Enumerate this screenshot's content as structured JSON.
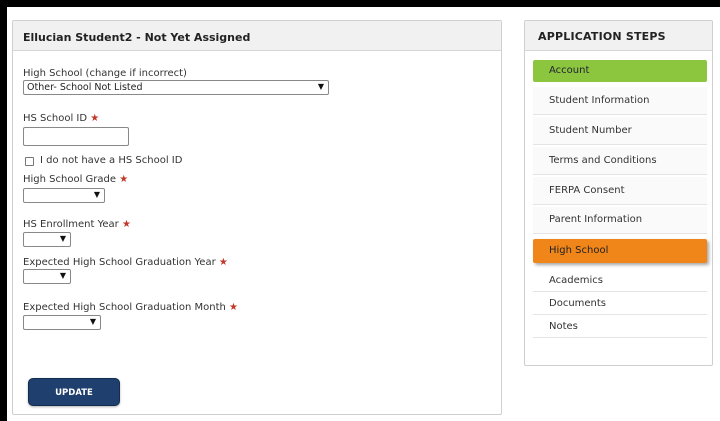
{
  "form": {
    "header": "Ellucian Student2 - Not Yet Assigned",
    "high_school_label": "High School (change if incorrect)",
    "high_school_value": "Other- School Not Listed",
    "hs_id_label": "HS School ID",
    "no_id_label": "I do not have a HS School ID",
    "grade_label": "High School Grade",
    "enrollment_year_label": "HS Enrollment Year",
    "grad_year_label": "Expected High School Graduation Year",
    "grad_month_label": "Expected High School Graduation Month",
    "required_marker": "★",
    "update_label": "UPDATE"
  },
  "steps": {
    "title": "APPLICATION STEPS",
    "items": [
      {
        "label": "Account",
        "state": "complete"
      },
      {
        "label": "Student Information",
        "state": "pending"
      },
      {
        "label": "Student Number",
        "state": "pending"
      },
      {
        "label": "Terms and Conditions",
        "state": "pending"
      },
      {
        "label": "FERPA Consent",
        "state": "pending"
      },
      {
        "label": "Parent Information",
        "state": "pending"
      },
      {
        "label": "High School",
        "state": "current"
      },
      {
        "label": "Academics",
        "state": "pending"
      },
      {
        "label": "Documents",
        "state": "pending"
      },
      {
        "label": "Notes",
        "state": "pending"
      }
    ]
  },
  "colors": {
    "complete": "#8cc63f",
    "current": "#f0861a",
    "button": "#1f3f6e",
    "required": "#c0392b"
  },
  "icons": {
    "select_arrow": "chevron-down-icon"
  }
}
